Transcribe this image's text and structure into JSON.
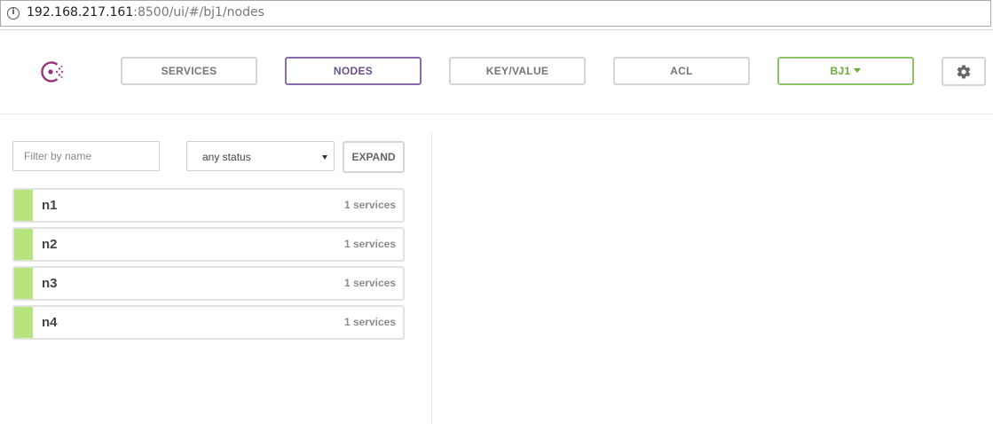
{
  "browser": {
    "url_host": "192.168.217.161",
    "url_rest": ":8500/ui/#/bj1/nodes",
    "info_icon": "info-icon"
  },
  "nav": {
    "logo_icon": "consul-logo-icon",
    "items": [
      {
        "label": "SERVICES"
      },
      {
        "label": "NODES"
      },
      {
        "label": "KEY/VALUE"
      },
      {
        "label": "ACL"
      }
    ],
    "active": "NODES",
    "datacenter": "BJ1",
    "settings_icon": "gear-icon",
    "colors": {
      "active": "#8b6bb0",
      "datacenter": "#6aab3c",
      "healthy": "#b6e57f"
    }
  },
  "filters": {
    "name_placeholder": "Filter by name",
    "status_value": "any status",
    "expand_label": "EXPAND"
  },
  "nodes": [
    {
      "name": "n1",
      "services": "1 services"
    },
    {
      "name": "n2",
      "services": "1 services"
    },
    {
      "name": "n3",
      "services": "1 services"
    },
    {
      "name": "n4",
      "services": "1 services"
    }
  ]
}
